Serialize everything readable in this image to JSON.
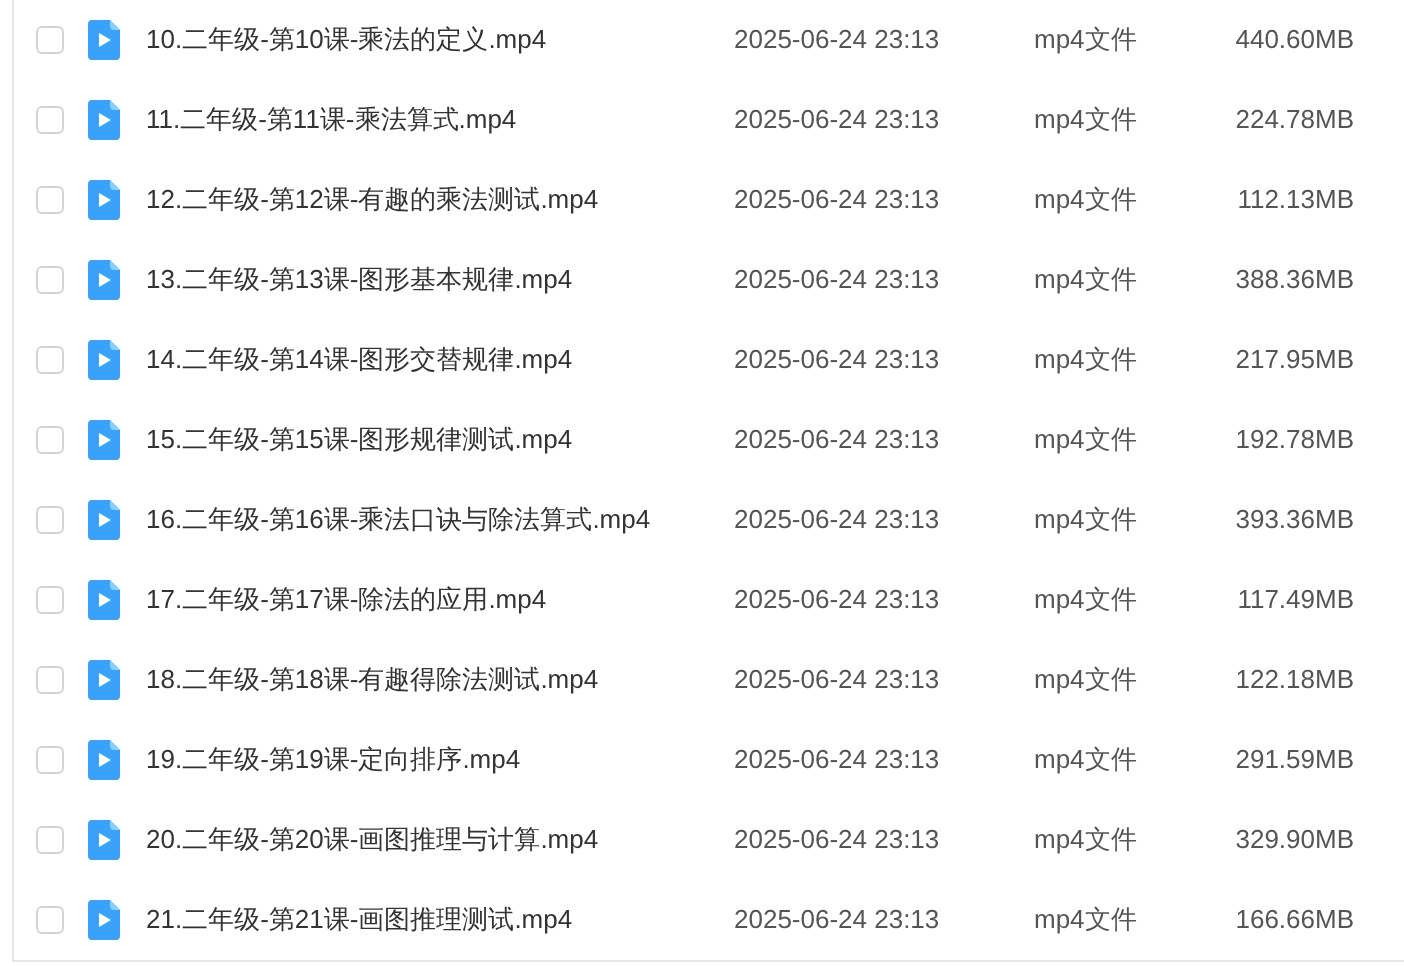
{
  "files": [
    {
      "checked": false,
      "name": "10.二年级-第10课-乘法的定义.mp4",
      "modified": "2025-06-24 23:13",
      "type": "mp4文件",
      "size": "440.60MB"
    },
    {
      "checked": false,
      "name": "11.二年级-第11课-乘法算式.mp4",
      "modified": "2025-06-24 23:13",
      "type": "mp4文件",
      "size": "224.78MB"
    },
    {
      "checked": false,
      "name": "12.二年级-第12课-有趣的乘法测试.mp4",
      "modified": "2025-06-24 23:13",
      "type": "mp4文件",
      "size": "112.13MB"
    },
    {
      "checked": false,
      "name": "13.二年级-第13课-图形基本规律.mp4",
      "modified": "2025-06-24 23:13",
      "type": "mp4文件",
      "size": "388.36MB"
    },
    {
      "checked": false,
      "name": "14.二年级-第14课-图形交替规律.mp4",
      "modified": "2025-06-24 23:13",
      "type": "mp4文件",
      "size": "217.95MB"
    },
    {
      "checked": false,
      "name": "15.二年级-第15课-图形规律测试.mp4",
      "modified": "2025-06-24 23:13",
      "type": "mp4文件",
      "size": "192.78MB"
    },
    {
      "checked": false,
      "name": "16.二年级-第16课-乘法口诀与除法算式.mp4",
      "modified": "2025-06-24 23:13",
      "type": "mp4文件",
      "size": "393.36MB"
    },
    {
      "checked": false,
      "name": "17.二年级-第17课-除法的应用.mp4",
      "modified": "2025-06-24 23:13",
      "type": "mp4文件",
      "size": "117.49MB"
    },
    {
      "checked": false,
      "name": "18.二年级-第18课-有趣得除法测试.mp4",
      "modified": "2025-06-24 23:13",
      "type": "mp4文件",
      "size": "122.18MB"
    },
    {
      "checked": false,
      "name": "19.二年级-第19课-定向排序.mp4",
      "modified": "2025-06-24 23:13",
      "type": "mp4文件",
      "size": "291.59MB"
    },
    {
      "checked": false,
      "name": "20.二年级-第20课-画图推理与计算.mp4",
      "modified": "2025-06-24 23:13",
      "type": "mp4文件",
      "size": "329.90MB"
    },
    {
      "checked": false,
      "name": "21.二年级-第21课-画图推理测试.mp4",
      "modified": "2025-06-24 23:13",
      "type": "mp4文件",
      "size": "166.66MB"
    }
  ]
}
